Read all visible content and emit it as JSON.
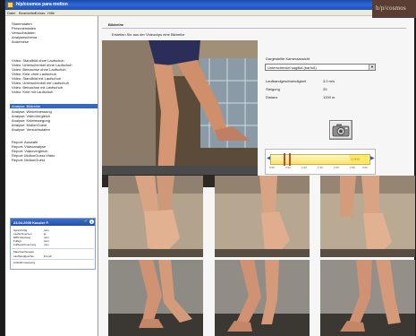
{
  "window": {
    "title": "h/p/cosmos para motion",
    "menu": [
      "Datei",
      "Bearbeiten",
      "Extras",
      "Hilfe"
    ]
  },
  "sidebar": {
    "groups": [
      [
        "Stammdaten",
        "Personendaten",
        "Versuchsdaten",
        "Analyseschema",
        "Anamnese"
      ],
      [
        "Video: Standbild ohne Laufschuh",
        "Video: Unterschenkel ohne Laufschuh",
        "Video: Beinachse ohne Laufschuh",
        "Video: Knie ohne Laufschuh",
        "Video: Standbild mit Laufschuh",
        "Video: Unterschenkel mit Laufschuh",
        "Video: Beinachse mit Laufschuh",
        "Video: Knie mit Laufschuh"
      ],
      [
        "Analyse: Bildreihe",
        "Analyse: Winkelmessung",
        "Analyse: VideoVergleich",
        "Analyse: Kniebewegung",
        "Analyse: MotionGuest",
        "Analyse: Versuchsdaten"
      ],
      [
        "Report: Auswahl",
        "Report: Videoanalyse",
        "Report: Videovergleich",
        "Report: MotionGuest-Video",
        "Report: MotionGuest"
      ]
    ],
    "selected": "Analyse: Bildreihe"
  },
  "patient": {
    "title": "23.04.2005 Kaszler F.",
    "rows": [
      {
        "label": "Spreizfußig",
        "value": "nein"
      },
      {
        "label": "Laufschmerzen",
        "value": "ja"
      },
      {
        "label": "ERN-Messwig",
        "value": "nein"
      },
      {
        "label": "Fußtyp",
        "value": "nein"
      },
      {
        "label": "Fußbeschmerzung",
        "value": "nein"
      }
    ],
    "sections": [
      {
        "label": "Maschentherapie",
        "value": ""
      },
      {
        "label": "Laufbandgeschw.",
        "value": "8 km/h"
      },
      {
        "label": "Antibahnmessung",
        "value": ""
      }
    ]
  },
  "main": {
    "title": "Bildreihe",
    "subtitle": "Erstellen Sie aus der Videoclips eine Bildreihe",
    "logo": "h/p/cosmos",
    "perspective_label": "Dargestellte Kameraansicht",
    "perspective_value": "Unterschenkel sagittal (barfuß)",
    "params": [
      {
        "label": "Laufbandgeschwindigkeit",
        "value": "3.0 m/s"
      },
      {
        "label": "Steigung",
        "value": "25"
      },
      {
        "label": "Distanz",
        "value": "1200 m"
      }
    ],
    "timeline": {
      "ticks": [
        "0.00",
        "0.50",
        "1.00",
        "1.50",
        "2.00",
        "2.50",
        "3.00"
      ],
      "value": "1.000",
      "marker_positions": [
        0.13,
        0.19
      ]
    }
  },
  "colors": {
    "selection": "#3168c6",
    "titlebar": "#2f68d8",
    "logo_bg": "#5a3e34",
    "timeline_yellow": "#ffe26a"
  }
}
